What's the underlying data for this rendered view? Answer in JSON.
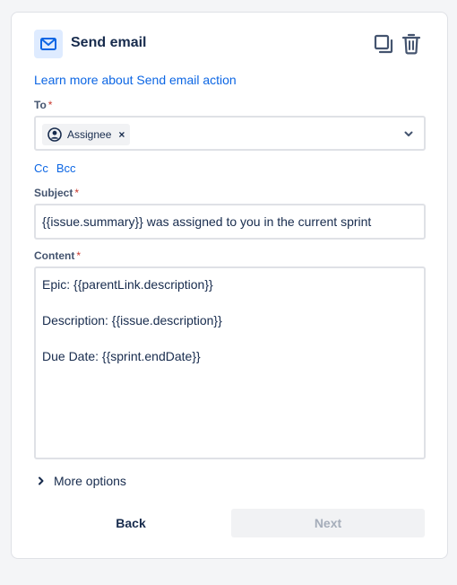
{
  "header": {
    "title": "Send email",
    "icons": {
      "action": "mail-icon",
      "copy": "copy-icon",
      "delete": "trash-icon"
    }
  },
  "learn_link": "Learn more about Send email action",
  "to_field": {
    "label": "To",
    "required_mark": "*",
    "chip_label": "Assignee",
    "chip_remove": "×"
  },
  "cc_links": {
    "cc": "Cc",
    "bcc": "Bcc"
  },
  "subject_field": {
    "label": "Subject",
    "required_mark": "*",
    "value": "{{issue.summary}} was assigned to you in the current sprint"
  },
  "content_field": {
    "label": "Content",
    "required_mark": "*",
    "lines": [
      "Epic: {{parentLink.description}}",
      "Description: {{issue.description}}",
      "Due Date: {{sprint.endDate}}"
    ]
  },
  "more_options": "More options",
  "buttons": {
    "back": "Back",
    "next": "Next"
  },
  "colors": {
    "link": "#0c66e4",
    "text": "#172b4d",
    "required": "#c9372c",
    "border": "#dfe1e6",
    "icon_badge_bg": "#deebff",
    "disabled_bg": "#f1f2f4",
    "disabled_text": "#a5adba"
  }
}
